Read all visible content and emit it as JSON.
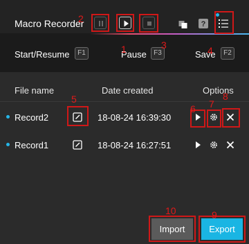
{
  "header": {
    "title": "Macro Recorder",
    "controls": [
      {
        "name": "pause",
        "icon": "pause-icon"
      },
      {
        "name": "play",
        "icon": "play-icon"
      },
      {
        "name": "stop",
        "icon": "stop-icon"
      }
    ],
    "icons": [
      "copy-icon",
      "help-icon",
      "list-icon"
    ]
  },
  "hotkeys": [
    {
      "label": "Start/Resume",
      "key": "F1"
    },
    {
      "label": "Pause",
      "key": "F3"
    },
    {
      "label": "Save",
      "key": "F2"
    }
  ],
  "table": {
    "columns": [
      "File name",
      "Date created",
      "Options"
    ],
    "rows": [
      {
        "name": "Record2",
        "date": "18-08-24 16:39:30"
      },
      {
        "name": "Record1",
        "date": "18-08-24 16:27:51"
      }
    ]
  },
  "footer": {
    "import_label": "Import",
    "export_label": "Export"
  },
  "annotations": [
    "1",
    "2",
    "3",
    "4",
    "5",
    "6",
    "7",
    "8",
    "9",
    "10"
  ],
  "colors": {
    "accent": "#1ab5e3",
    "annotation": "#d01818",
    "background": "#1b1b1b",
    "panel": "#2b2b2b"
  }
}
